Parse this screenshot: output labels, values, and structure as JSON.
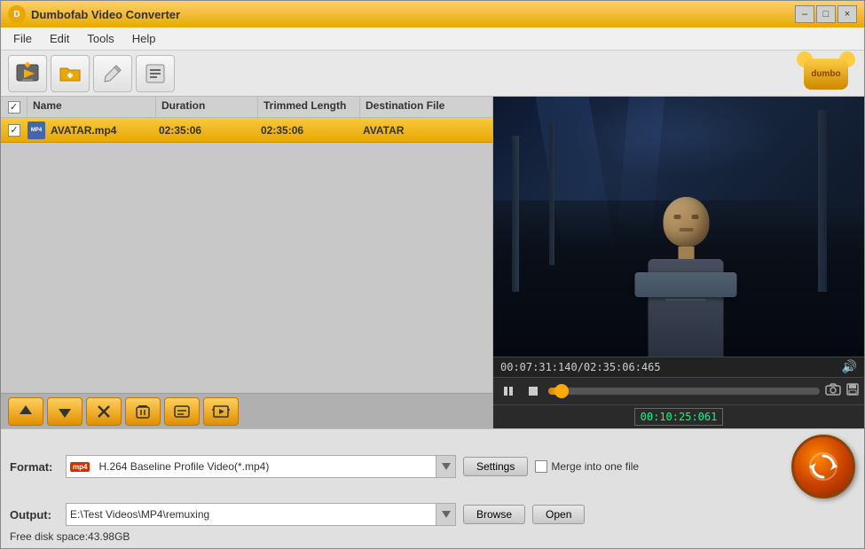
{
  "window": {
    "title": "Dumbofab Video Converter",
    "icon": "D"
  },
  "title_buttons": {
    "minimize": "–",
    "maximize": "□",
    "close": "×"
  },
  "menu": {
    "items": [
      {
        "label": "File"
      },
      {
        "label": "Edit"
      },
      {
        "label": "Tools"
      },
      {
        "label": "Help"
      }
    ]
  },
  "toolbar": {
    "add_video_label": "＋",
    "add_folder_label": "📁",
    "edit_label": "✎",
    "list_label": "☰"
  },
  "file_list": {
    "headers": {
      "name": "Name",
      "duration": "Duration",
      "trimmed_length": "Trimmed Length",
      "destination_file": "Destination File"
    },
    "rows": [
      {
        "checked": true,
        "icon": "MP4",
        "name": "AVATAR.mp4",
        "duration": "02:35:06",
        "trimmed_length": "02:35:06",
        "destination": "AVATAR"
      }
    ]
  },
  "action_buttons": {
    "move_up": "▲",
    "move_down": "▼",
    "delete": "✕",
    "clear": "🗑",
    "subtitle": "💬",
    "effect": "🎞"
  },
  "video_preview": {
    "time_display": "00:07:31:140/02:35:06:465",
    "current_time": "00:10:25:061",
    "controls": {
      "pause": "⏸",
      "stop": "⏹",
      "camera": "📷",
      "volume": "🔊"
    }
  },
  "format_bar": {
    "format_label": "Format:",
    "format_value": "H.264 Baseline Profile Video(*.mp4)",
    "format_icon_text": "mp4",
    "settings_label": "Settings",
    "merge_label": "Merge into one file",
    "output_label": "Output:",
    "output_path": "E:\\Test Videos\\MP4\\remuxing",
    "browse_label": "Browse",
    "open_label": "Open",
    "disk_space": "Free disk space:43.98GB"
  }
}
